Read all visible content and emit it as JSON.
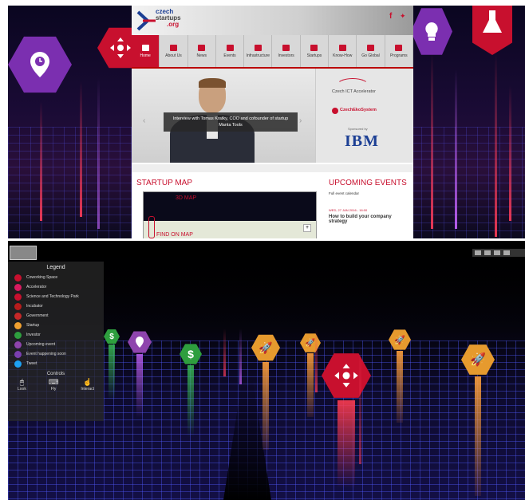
{
  "top": {
    "logo": {
      "line1": "czech",
      "line2": "startups",
      "line3": ".org"
    },
    "nav": [
      {
        "label": "Home",
        "active": true
      },
      {
        "label": "About Us"
      },
      {
        "label": "News"
      },
      {
        "label": "Events"
      },
      {
        "label": "Infrastructure"
      },
      {
        "label": "Investors"
      },
      {
        "label": "Startups"
      },
      {
        "label": "Know-How"
      },
      {
        "label": "Go Global"
      },
      {
        "label": "Programs"
      }
    ],
    "hero_caption": "Interview with Tomas Kratky, COO and cofounder of startup Manta Tools",
    "sponsors": {
      "s1": "Czech ICT Accelerator",
      "s2": "CzechEkoSystem",
      "s3_label": "Sponsored by",
      "s3": "IBM"
    },
    "startup_map": {
      "title": "STARTUP MAP",
      "map3d": "3D MAP",
      "find": "FIND ON MAP"
    },
    "events": {
      "title": "UPCOMING EVENTS",
      "link": "Full event calendar",
      "date": "WED, 27 JAN 2016 - 16:00",
      "event_title": "How to build your company strategy"
    }
  },
  "bottom": {
    "legend_title": "Legend",
    "legend": [
      {
        "label": "Coworking Space",
        "color": "#c8102e"
      },
      {
        "label": "Accelerator",
        "color": "#d81b60"
      },
      {
        "label": "Science and Technology Park",
        "color": "#c8102e"
      },
      {
        "label": "Incubator",
        "color": "#b71c1c"
      },
      {
        "label": "Government",
        "color": "#c62828"
      },
      {
        "label": "Startup",
        "color": "#f0a030"
      },
      {
        "label": "Investor",
        "color": "#2e9e3e"
      },
      {
        "label": "Upcoming event",
        "color": "#8e44ad"
      },
      {
        "label": "Event happening soon",
        "color": "#7b3fb0"
      },
      {
        "label": "Tweet",
        "color": "#1da1f2"
      }
    ],
    "controls_title": "Controls",
    "controls": {
      "left": "Look",
      "mid": "Fly",
      "right": "Interact"
    }
  },
  "colors": {
    "brand_red": "#c8102e",
    "purple": "#7b2fb0",
    "grid_blue": "#3b3bff"
  }
}
